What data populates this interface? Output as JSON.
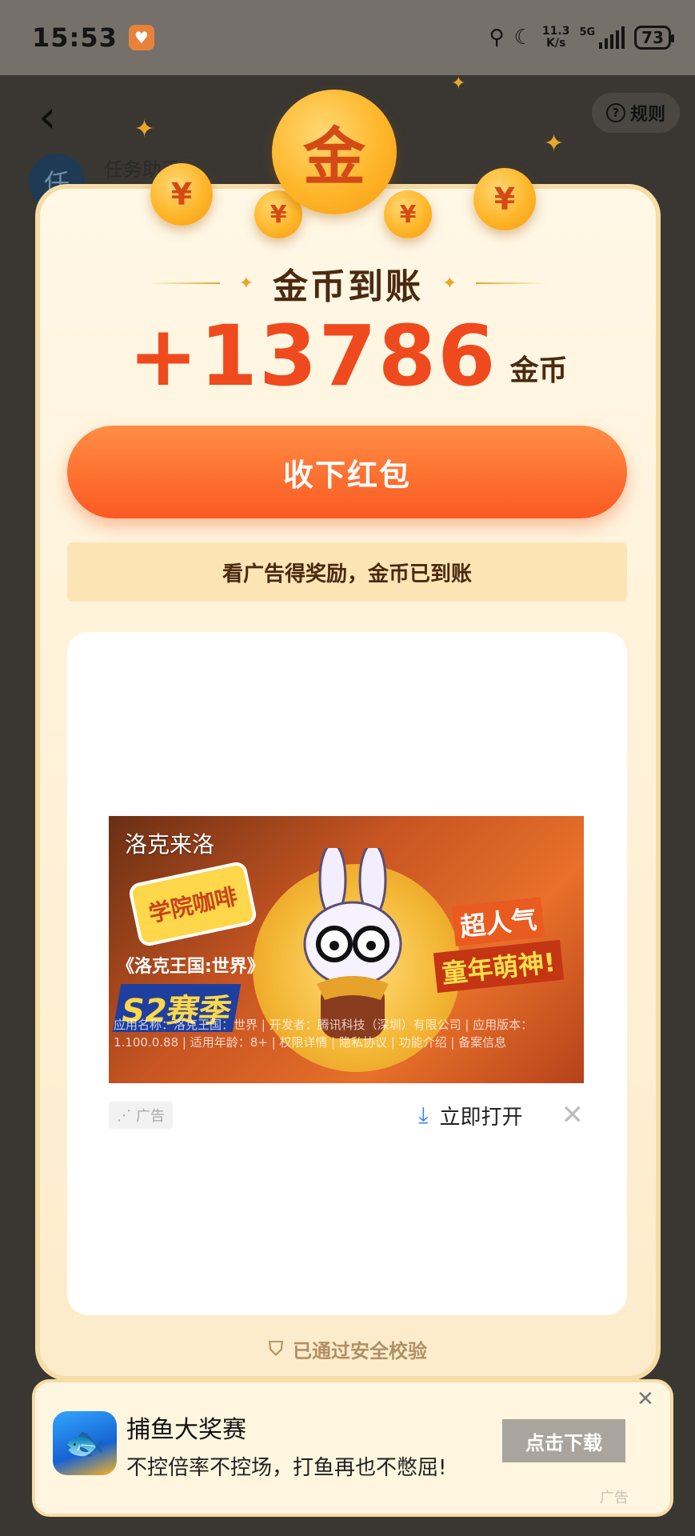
{
  "status_bar": {
    "time": "15:53",
    "net_speed_value": "11.3",
    "net_speed_unit": "K/s",
    "network": "5G",
    "battery": "73"
  },
  "background": {
    "rules_label": "规则",
    "avatar_char": "任",
    "task_label": "任务助手"
  },
  "modal": {
    "coin_main_char": "金",
    "coin_symbol": "¥",
    "title": "金币到账",
    "amount": "+13786",
    "amount_unit": "金币",
    "collect_button": "收下红包",
    "ad_tip": "看广告得奖励，金币已到账",
    "security_text": "已通过安全校验"
  },
  "ad": {
    "banner_title": "洛克来洛",
    "badge": "学院咖啡",
    "season_title": "《洛克王国:世界》",
    "season_num": "S2赛季",
    "slogan_1": "超人气",
    "slogan_2": "童年萌神!",
    "fineprint": "应用名称：洛克王国：世界 | 开发者：腾讯科技（深圳）有限公司 | 应用版本：1.100.0.88 | 适用年龄：8+ | 权限详情 | 隐私协议 | 功能介绍 | 备案信息",
    "tag": "广告",
    "open_label": "立即打开"
  },
  "bottom_ad": {
    "title": "捕鱼大奖赛",
    "desc": "不控倍率不控场，打鱼再也不憋屈!",
    "download_button": "点击下载",
    "tag": "广告"
  },
  "colors": {
    "accent_orange": "#fb5a22",
    "amount_red": "#ef4a1e",
    "title_brown": "#4b2a10",
    "coin_gold": "#ffb629"
  }
}
